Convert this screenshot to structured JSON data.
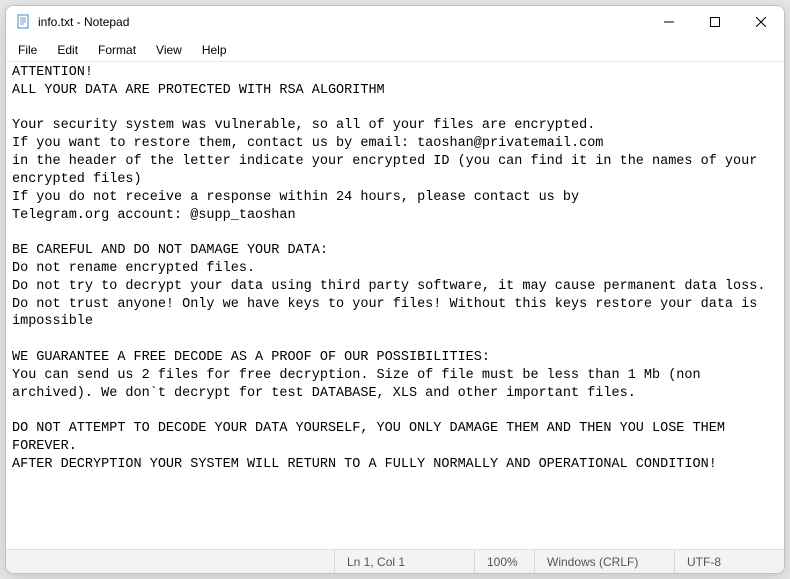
{
  "title": "info.txt - Notepad",
  "menu": {
    "file": "File",
    "edit": "Edit",
    "format": "Format",
    "view": "View",
    "help": "Help"
  },
  "content": "ATTENTION!\nALL YOUR DATA ARE PROTECTED WITH RSA ALGORITHM\n\nYour security system was vulnerable, so all of your files are encrypted.\nIf you want to restore them, contact us by email: taoshan@privatemail.com\nin the header of the letter indicate your encrypted ID (you can find it in the names of your encrypted files)\nIf you do not receive a response within 24 hours, please contact us by\nTelegram.org account: @supp_taoshan\n\nBE CAREFUL AND DO NOT DAMAGE YOUR DATA:\nDo not rename encrypted files.\nDo not try to decrypt your data using third party software, it may cause permanent data loss.\nDo not trust anyone! Only we have keys to your files! Without this keys restore your data is impossible\n\nWE GUARANTEE A FREE DECODE AS A PROOF OF OUR POSSIBILITIES:\nYou can send us 2 files for free decryption. Size of file must be less than 1 Mb (non archived). We don`t decrypt for test DATABASE, XLS and other important files.\n\nDO NOT ATTEMPT TO DECODE YOUR DATA YOURSELF, YOU ONLY DAMAGE THEM AND THEN YOU LOSE THEM FOREVER.\nAFTER DECRYPTION YOUR SYSTEM WILL RETURN TO A FULLY NORMALLY AND OPERATIONAL CONDITION!",
  "status": {
    "position": "Ln 1, Col 1",
    "zoom": "100%",
    "eol": "Windows (CRLF)",
    "encoding": "UTF-8"
  }
}
